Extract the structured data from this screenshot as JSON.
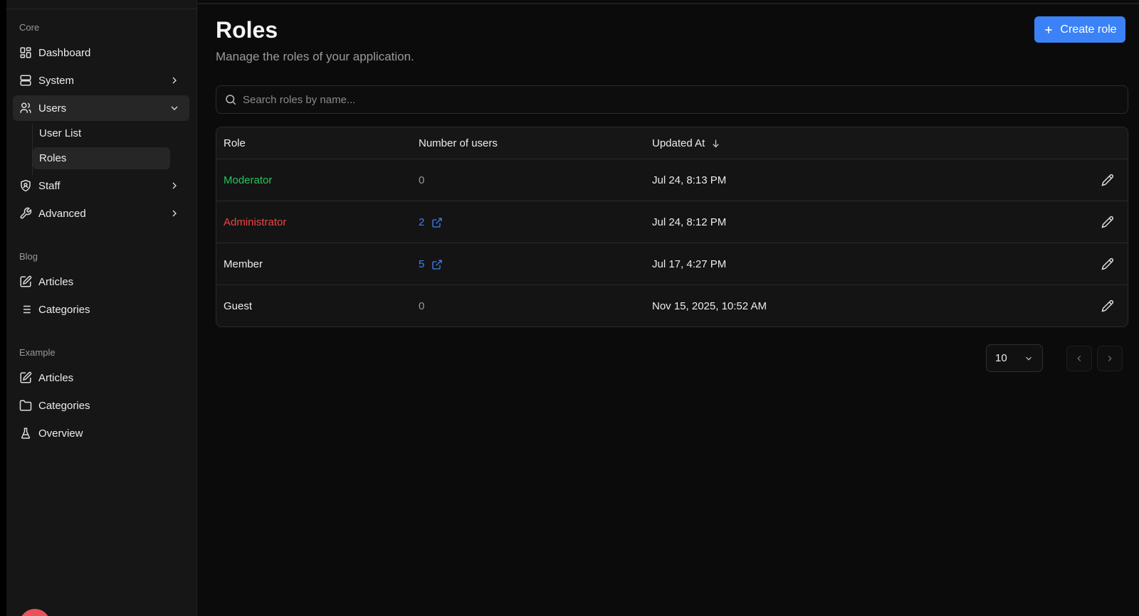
{
  "sidebar": {
    "groups": {
      "core": "Core",
      "blog": "Blog",
      "example": "Example"
    },
    "items": {
      "dashboard": "Dashboard",
      "system": "System",
      "users": "Users",
      "user_list": "User List",
      "roles": "Roles",
      "staff": "Staff",
      "advanced": "Advanced",
      "blog_articles": "Articles",
      "blog_categories": "Categories",
      "example_articles": "Articles",
      "example_categories": "Categories",
      "overview": "Overview"
    }
  },
  "header": {
    "title": "Roles",
    "subtitle": "Manage the roles of your application.",
    "create_label": "Create role"
  },
  "search": {
    "placeholder": "Search roles by name..."
  },
  "table": {
    "columns": {
      "role": "Role",
      "users": "Number of users",
      "updated": "Updated At"
    },
    "rows": [
      {
        "role": "Moderator",
        "role_color": "#22c55e",
        "users": "0",
        "users_link": false,
        "updated": "Jul 24, 8:13 PM"
      },
      {
        "role": "Administrator",
        "role_color": "#ef4444",
        "users": "2",
        "users_link": true,
        "updated": "Jul 24, 8:12 PM"
      },
      {
        "role": "Member",
        "role_color": "#ececec",
        "users": "5",
        "users_link": true,
        "updated": "Jul 17, 4:27 PM"
      },
      {
        "role": "Guest",
        "role_color": "#ececec",
        "users": "0",
        "users_link": false,
        "updated": "Nov 15, 2025, 10:52 AM"
      }
    ]
  },
  "pagination": {
    "per_page": "10"
  },
  "colors": {
    "accent": "#3b82f6",
    "moderator": "#22c55e",
    "administrator": "#ef4444"
  }
}
